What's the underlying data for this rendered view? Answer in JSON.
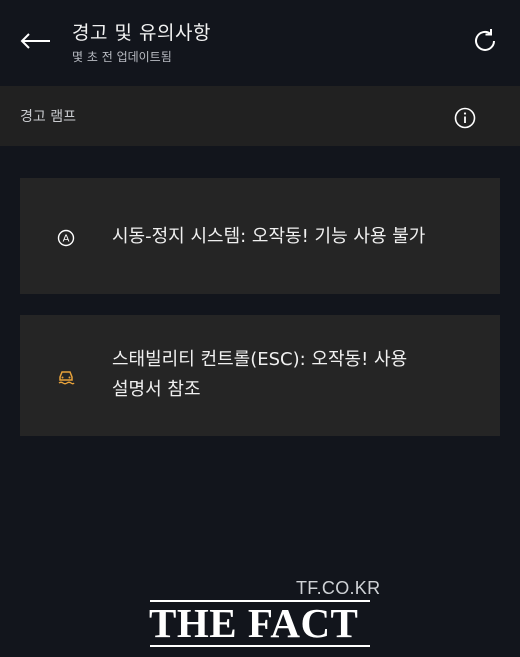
{
  "header": {
    "title": "경고 및 유의사항",
    "subtitle": "몇 초 전 업데이트됨",
    "back_icon": "arrow-left-icon",
    "refresh_icon": "refresh-icon"
  },
  "section": {
    "label": "경고 램프",
    "info_icon": "info-icon"
  },
  "warnings": [
    {
      "icon": "auto-start-stop-icon",
      "icon_color": "#ffffff",
      "lines": [
        "시동-정지 시스템: 오작동! 기능 사용 불가"
      ]
    },
    {
      "icon": "stability-control-icon",
      "icon_color": "#e8a23a",
      "lines": [
        "스태빌리티 컨트롤(ESC): 오작동! 사용",
        "설명서 참조"
      ]
    }
  ],
  "watermark": {
    "small": "TF.CO.KR",
    "big": "THE FACT"
  },
  "colors": {
    "background": "#12151c",
    "section_bar": "#212121",
    "card": "#252525",
    "warning_amber": "#e8a23a"
  }
}
